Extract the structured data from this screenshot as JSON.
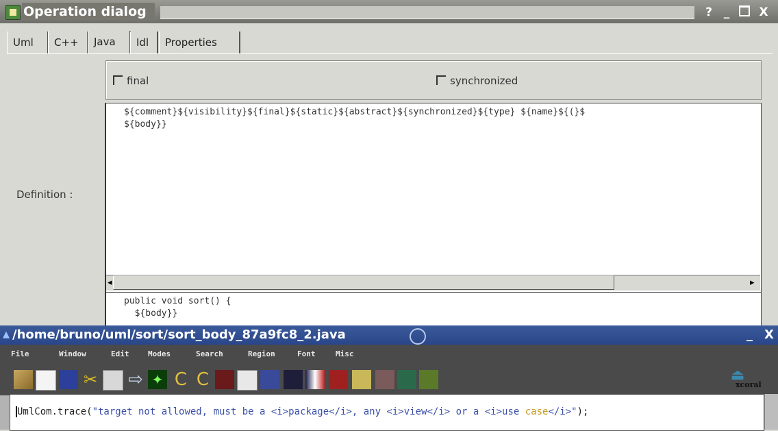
{
  "dialog": {
    "title": "Operation dialog",
    "buttons": {
      "help": "?",
      "minimize": "_",
      "maximize": "□",
      "close": "X"
    },
    "tabs": [
      "Uml",
      "C++",
      "Java",
      "Idl",
      "Properties"
    ],
    "selected_tab": "Java",
    "checkboxes": [
      {
        "label": "final",
        "checked": false
      },
      {
        "label": "synchronized",
        "checked": false
      }
    ],
    "definition_label": "Definition :",
    "definition_lines": [
      "${comment}${visibility}${final}${static}${abstract}${synchronized}${type} ${name}${(}$",
      "${body}}"
    ],
    "declaration_lines": [
      "public void sort() {",
      "  ${body}}"
    ]
  },
  "editor": {
    "title": "/home/bruno/uml/sort/sort_body_87a9fc8_2.java",
    "buttons": {
      "minimize": "_",
      "close": "X"
    },
    "menu": [
      "File",
      "Window",
      "Edit",
      "Modes",
      "Search",
      "Region",
      "Font",
      "Misc"
    ],
    "logo_text": "xcoral",
    "code_parts": [
      {
        "text": "UmlCom.trace(",
        "color": "#222222"
      },
      {
        "text": "\"target not allowed, must be a <i>package</i>, any <i>view</i> or a <i>use ",
        "color": "#3a4fa8"
      },
      {
        "text": "case",
        "color": "#c89a1a"
      },
      {
        "text": "</i>\"",
        "color": "#3a4fa8"
      },
      {
        "text": ");",
        "color": "#222222"
      }
    ]
  }
}
